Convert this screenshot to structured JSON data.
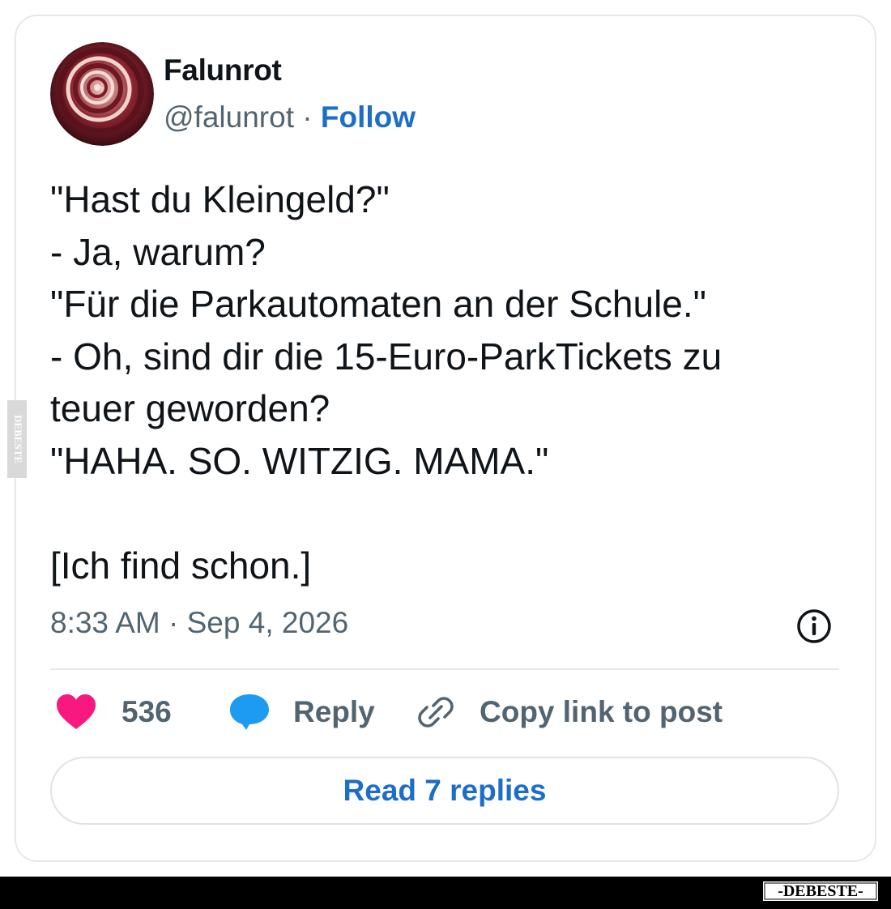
{
  "tweet": {
    "author": {
      "display_name": "Falunrot",
      "handle": "@falunrot",
      "separator": "·",
      "follow_label": "Follow"
    },
    "text_lines": [
      "\"Hast du Kleingeld?\"",
      "- Ja, warum?",
      "\"Für die Parkautomaten an der Schule.\"",
      "- Oh, sind dir die 15-Euro-ParkTickets zu",
      "teuer geworden?",
      "\"HAHA. SO. WITZIG. MAMA.\"",
      "",
      "[Ich find schon.]"
    ],
    "timestamp": "8:33 AM · Sep 4, 2026",
    "actions": {
      "like_count": "536",
      "reply_label": "Reply",
      "copy_link_label": "Copy link to post"
    },
    "read_replies_label": "Read 7 replies"
  },
  "icons": {
    "heart": "heart-icon",
    "reply": "speech-bubble-icon",
    "copy_link": "link-icon",
    "info": "info-icon"
  },
  "colors": {
    "like_pink": "#f91880",
    "reply_blue": "#1d9bf0",
    "link_blue": "#1d6ec8",
    "text_primary": "#0f1419",
    "text_secondary": "#536471"
  },
  "watermark": {
    "side_text": "DEBESTE",
    "bottom_text": "-DEBESTE-"
  }
}
